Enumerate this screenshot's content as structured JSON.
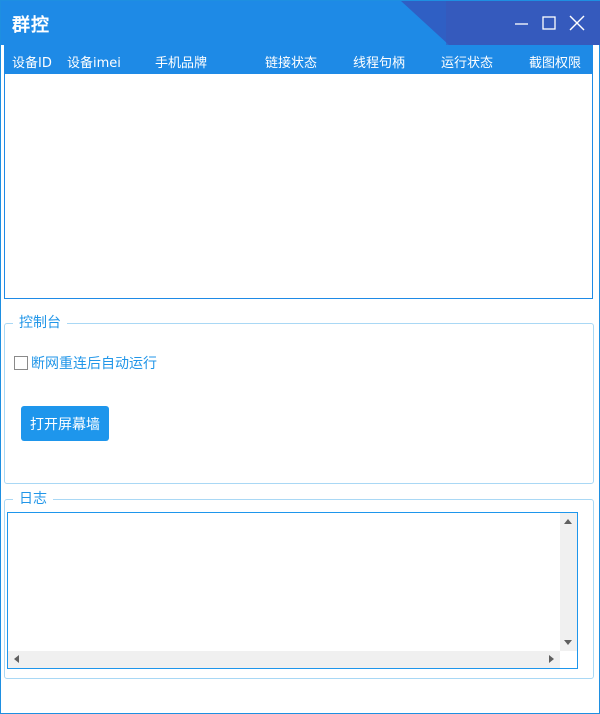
{
  "window": {
    "title": "群控"
  },
  "titlebar": {
    "icons": [
      "minimize-icon",
      "maximize-icon",
      "close-icon"
    ],
    "colors": {
      "bar": "#1e8ae6",
      "accent": "#2f5fc4"
    }
  },
  "grid": {
    "columns": [
      "设备ID",
      "设备imei",
      "手机品牌",
      "链接状态",
      "线程句柄",
      "运行状态",
      "截图权限"
    ],
    "rows": []
  },
  "console": {
    "legend": "控制台",
    "auto_run_checkbox": {
      "label": "断网重连后自动运行",
      "checked": false
    },
    "open_wall_button": "打开屏幕墙"
  },
  "log": {
    "legend": "日志",
    "content": ""
  }
}
